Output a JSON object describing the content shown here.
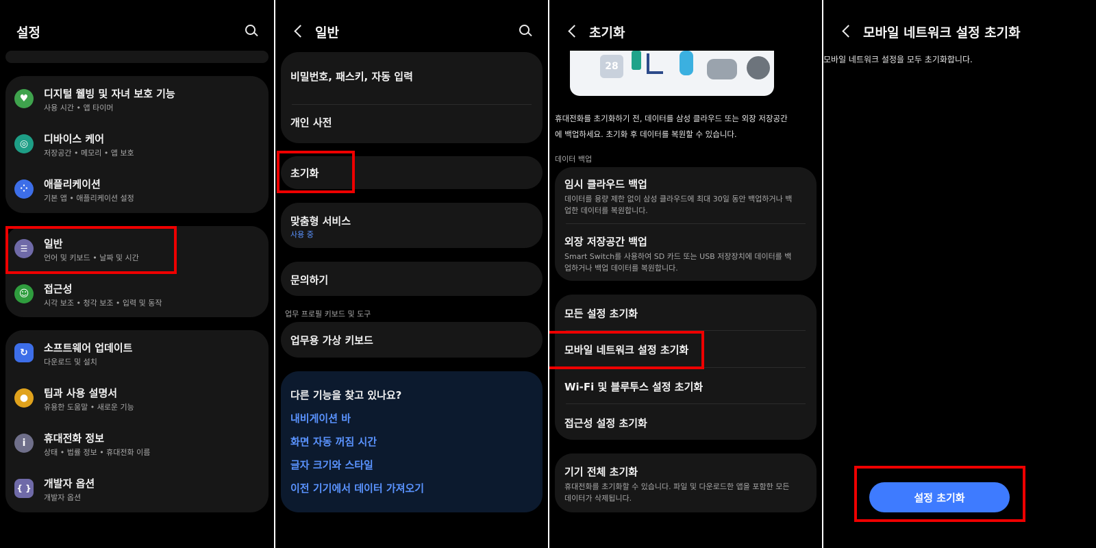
{
  "panel1": {
    "title": "설정",
    "items": [
      {
        "title": "디지털 웰빙 및 자녀 보호 기능",
        "sub": "사용 시간 • 앱 타이머",
        "icon": "heart-icon",
        "color": "#3fa34d"
      },
      {
        "title": "디바이스 케어",
        "sub": "저장공간 • 메모리 • 앱 보호",
        "icon": "device-care-icon",
        "color": "#1e9e86"
      },
      {
        "title": "애플리케이션",
        "sub": "기본 앱 • 애플리케이션 설정",
        "icon": "apps-icon",
        "color": "#3d6ee8"
      },
      {
        "title": "일반",
        "sub": "언어 및 키보드 • 날짜 및 시간",
        "icon": "sliders-icon",
        "color": "#6f6aa8"
      },
      {
        "title": "접근성",
        "sub": "시각 보조 • 청각 보조 • 입력 및 동작",
        "icon": "accessibility-icon",
        "color": "#2f9d3e"
      },
      {
        "title": "소프트웨어 업데이트",
        "sub": "다운로드 및 설치",
        "icon": "update-icon",
        "color": "#3d6ee8"
      },
      {
        "title": "팁과 사용 설명서",
        "sub": "유용한 도움말 • 새로운 기능",
        "icon": "bulb-icon",
        "color": "#e0a21c"
      },
      {
        "title": "휴대전화 정보",
        "sub": "상태 • 법률 정보 • 휴대전화 이름",
        "icon": "info-icon",
        "color": "#6f6f8a"
      },
      {
        "title": "개발자 옵션",
        "sub": "개발자 옵션",
        "icon": "code-braces-icon",
        "color": "#6f6aa8"
      }
    ]
  },
  "panel2": {
    "title": "일반",
    "items": [
      {
        "title": "비밀번호, 패스키, 자동 입력"
      },
      {
        "title": "개인 사전"
      },
      {
        "title": "초기화"
      },
      {
        "title": "맞춤형 서비스",
        "sub": "사용 중"
      },
      {
        "title": "문의하기"
      },
      {
        "title": "업무용 가상 키보드"
      }
    ],
    "section_label": "업무 프로필 키보드 및 도구",
    "suggest_title": "다른 기능을 찾고 있나요?",
    "suggest_links": [
      "내비게이션 바",
      "화면 자동 꺼짐 시간",
      "글자 크기와 스타일",
      "이전 기기에서 데이터 가져오기"
    ]
  },
  "panel3": {
    "title": "초기화",
    "illustration_number": "28",
    "description": "휴대전화를 초기화하기 전, 데이터를 삼성 클라우드 또는 외장 저장공간에 백업하세요. 초기화 후 데이터를 복원할 수 있습니다.",
    "backup_label": "데이터 백업",
    "backup_items": [
      {
        "title": "임시 클라우드 백업",
        "sub": "데이터를 용량 제한 없이 삼성 클라우드에 최대 30일 동안 백업하거나 백업한 데이터를 복원합니다."
      },
      {
        "title": "외장 저장공간 백업",
        "sub": "Smart Switch를 사용하여 SD 카드 또는 USB 저장장치에 데이터를 백업하거나 백업 데이터를 복원합니다."
      }
    ],
    "reset_items": [
      "모든 설정 초기화",
      "모바일 네트워크 설정 초기화",
      "Wi-Fi 및 블루투스 설정 초기화",
      "접근성 설정 초기화"
    ],
    "factory": {
      "title": "기기 전체 초기화",
      "sub": "휴대전화를 초기화할 수 있습니다. 파일 및 다운로드한 앱을 포함한 모든 데이터가 삭제됩니다."
    }
  },
  "panel4": {
    "title": "모바일 네트워크 설정 초기화",
    "description": "모바일 네트워크 설정을 모두 초기화합니다.",
    "button": "설정 초기화"
  },
  "colors": {
    "highlight": "#ee0000",
    "link": "#5a93ff",
    "button": "#3e7bff",
    "card": "#171717"
  }
}
